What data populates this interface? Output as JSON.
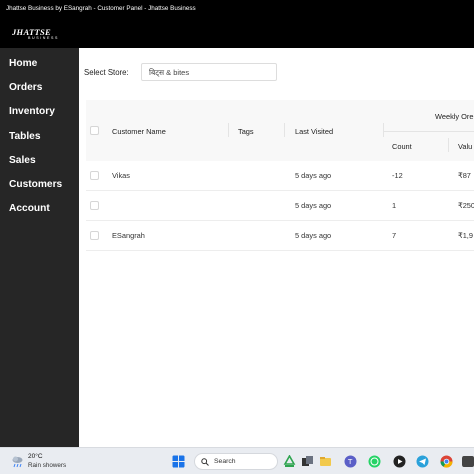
{
  "window": {
    "title": "Jhattse Business by ESangrah - Customer Panel - Jhattse Business"
  },
  "brand": {
    "logo_text": "JHATTSE",
    "logo_subtext": "BUSINESS"
  },
  "sidebar": {
    "items": [
      {
        "label": "Home"
      },
      {
        "label": "Orders"
      },
      {
        "label": "Inventory"
      },
      {
        "label": "Tables"
      },
      {
        "label": "Sales"
      },
      {
        "label": "Customers"
      },
      {
        "label": "Account"
      }
    ]
  },
  "store_selector": {
    "label": "Select Store:",
    "value": "बिट्स & bites"
  },
  "table": {
    "headers": {
      "customer_name": "Customer Name",
      "tags": "Tags",
      "last_visited": "Last Visited",
      "weekly_orders": "Weekly Ore",
      "count": "Count",
      "value": "Valu"
    },
    "rows": [
      {
        "name": "Vikas",
        "tags": "",
        "last_visited": "5 days ago",
        "count": "-12",
        "value": "₹87"
      },
      {
        "name": "",
        "tags": "",
        "last_visited": "5 days ago",
        "count": "1",
        "value": "₹250"
      },
      {
        "name": "ESangrah",
        "tags": "",
        "last_visited": "5 days ago",
        "count": "7",
        "value": "₹1,9"
      }
    ]
  },
  "taskbar": {
    "weather": {
      "temp": "20°C",
      "condition": "Rain showers"
    },
    "search_placeholder": "Search",
    "colors": {
      "windows_blue": "#1a73e8",
      "whatsapp": "#25d366",
      "telegram": "#2aa1da"
    }
  }
}
